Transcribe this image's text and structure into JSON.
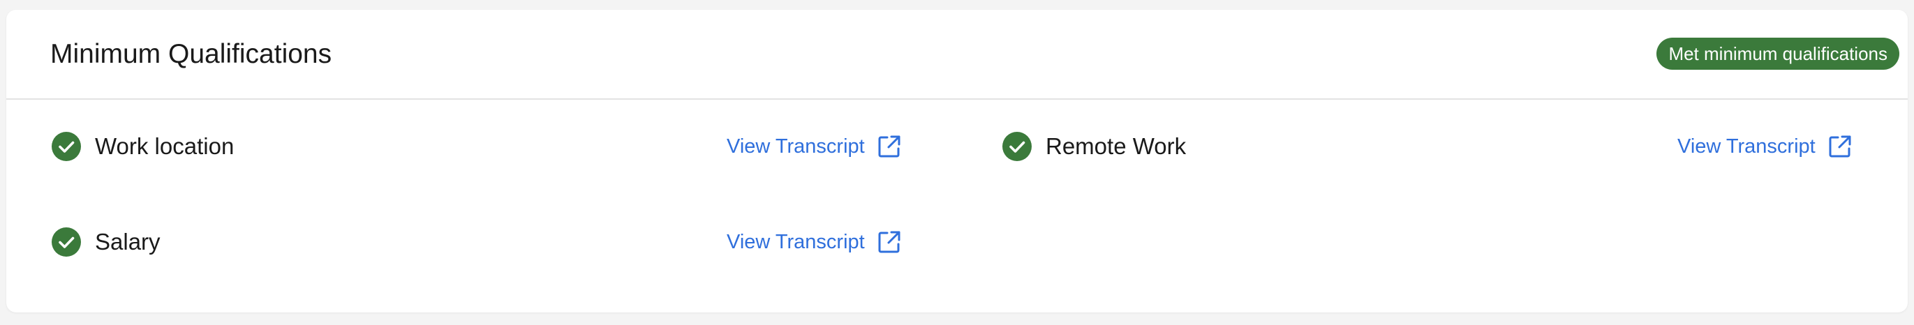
{
  "header": {
    "title": "Minimum Qualifications",
    "badge": "Met minimum qualifications"
  },
  "qualifications": [
    {
      "label": "Work location",
      "link": "View Transcript",
      "status": "met"
    },
    {
      "label": "Remote Work",
      "link": "View Transcript",
      "status": "met"
    },
    {
      "label": "Salary",
      "link": "View Transcript",
      "status": "met"
    }
  ],
  "colors": {
    "success": "#3b7a3b",
    "link": "#2f6fdc",
    "text": "#1a1a1a",
    "divider": "#e3e3e3"
  },
  "icons": {
    "check": "check-circle-icon",
    "external": "external-link-icon"
  }
}
